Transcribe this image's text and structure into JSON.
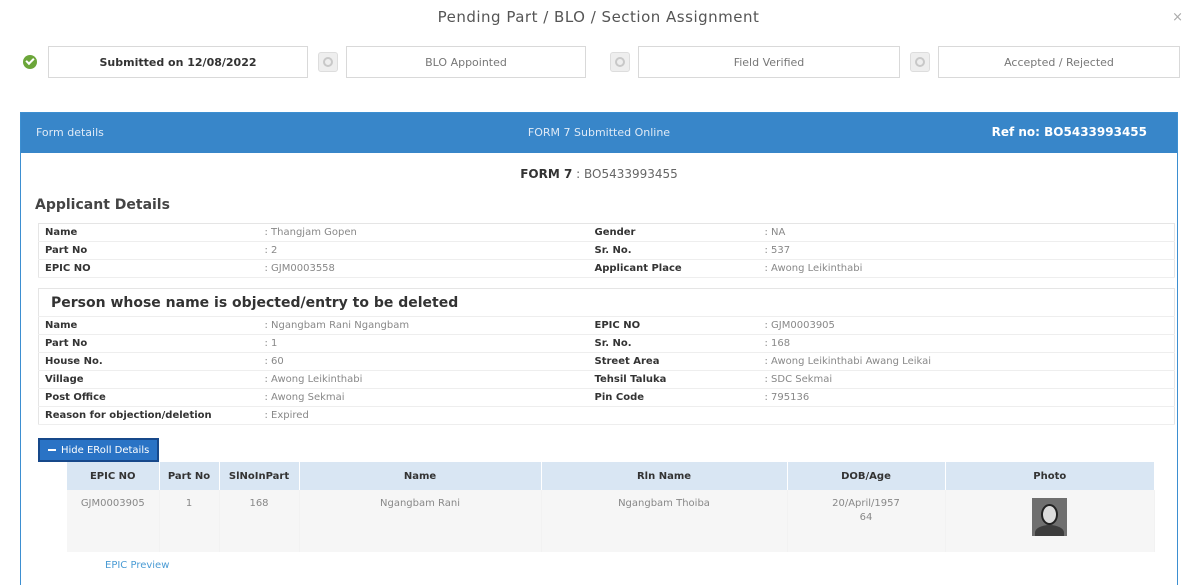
{
  "modal": {
    "title": "Pending Part / BLO / Section Assignment",
    "close": "×"
  },
  "steps": [
    {
      "label": "Submitted on 12/08/2022",
      "done": true
    },
    {
      "label": "BLO Appointed",
      "done": false
    },
    {
      "label": "Field Verified",
      "done": false
    },
    {
      "label": "Accepted / Rejected",
      "done": false
    }
  ],
  "panel": {
    "left": "Form details",
    "center": "FORM 7 Submitted Online",
    "ref": "Ref no: BO5433993455",
    "form_label": "FORM 7",
    "form_value": ": BO5433993455"
  },
  "applicant": {
    "heading": "Applicant Details",
    "rows": [
      {
        "k1": "Name",
        "v1": ": Thangjam Gopen",
        "k2": "Gender",
        "v2": ": NA"
      },
      {
        "k1": "Part No",
        "v1": ": 2",
        "k2": "Sr. No.",
        "v2": ": 537"
      },
      {
        "k1": "EPIC NO",
        "v1": ": GJM0003558",
        "k2": "Applicant Place",
        "v2": ": Awong Leikinthabi"
      }
    ]
  },
  "objected": {
    "heading": "Person whose name is objected/entry to be deleted",
    "rows": [
      {
        "k1": "Name",
        "v1": ": Ngangbam Rani Ngangbam",
        "k2": "EPIC NO",
        "v2": ": GJM0003905"
      },
      {
        "k1": "Part No",
        "v1": ": 1",
        "k2": "Sr. No.",
        "v2": ": 168"
      },
      {
        "k1": "House No.",
        "v1": ": 60",
        "k2": "Street Area",
        "v2": ": Awong Leikinthabi Awang Leikai"
      },
      {
        "k1": "Village",
        "v1": ": Awong Leikinthabi",
        "k2": "Tehsil Taluka",
        "v2": ": SDC Sekmai"
      },
      {
        "k1": "Post Office",
        "v1": ": Awong Sekmai",
        "k2": "Pin Code",
        "v2": ": 795136"
      },
      {
        "k1": "Reason for objection/deletion",
        "v1": ": Expired",
        "k2": "",
        "v2": ""
      }
    ]
  },
  "hide_button": "Hide ERoll Details",
  "eroll": {
    "headers": [
      "EPIC NO",
      "Part No",
      "SlNoInPart",
      "Name",
      "Rln Name",
      "DOB/Age",
      "Photo"
    ],
    "row": {
      "epic": "GJM0003905",
      "part": "1",
      "slno": "168",
      "name": "Ngangbam Rani",
      "rln": "Ngangbam Thoiba",
      "dob": "20/April/1957",
      "age": "64"
    }
  },
  "epic_preview": "EPIC Preview"
}
